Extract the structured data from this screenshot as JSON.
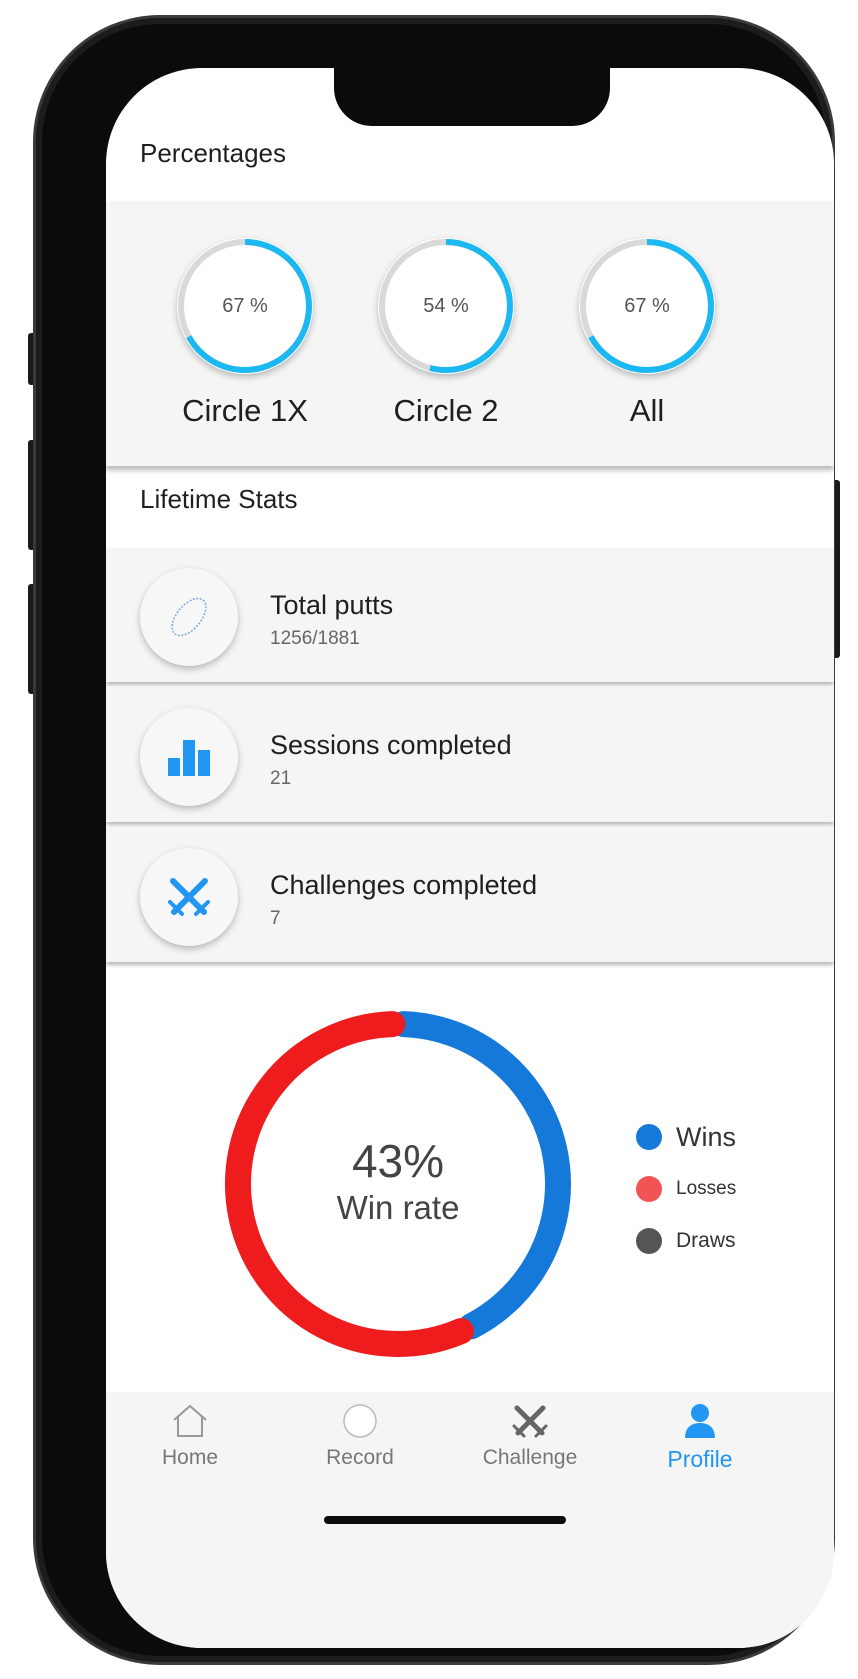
{
  "percentages": {
    "title": "Percentages",
    "gauges": [
      {
        "label": "Circle 1X",
        "value_text": "67 %",
        "value": 67
      },
      {
        "label": "Circle 2",
        "value_text": "54 %",
        "value": 54
      },
      {
        "label": "All",
        "value_text": "67 %",
        "value": 67
      }
    ]
  },
  "lifetime": {
    "title": "Lifetime Stats",
    "stats": [
      {
        "title": "Total putts",
        "value": "1256/1881",
        "icon": "putt-ball-icon"
      },
      {
        "title": "Sessions completed",
        "value": "21",
        "icon": "bar-chart-icon"
      },
      {
        "title": "Challenges completed",
        "value": "7",
        "icon": "crossed-swords-icon"
      }
    ]
  },
  "winrate": {
    "percent_text": "43%",
    "label": "Win rate",
    "legend": [
      {
        "label": "Wins",
        "color": "#1479d8"
      },
      {
        "label": "Losses",
        "color": "#f25355"
      },
      {
        "label": "Draws",
        "color": "#555555"
      }
    ]
  },
  "chart_data": {
    "type": "pie",
    "categories": [
      "Wins",
      "Losses",
      "Draws"
    ],
    "values": [
      43,
      57,
      0
    ],
    "colors": [
      "#1479d8",
      "#ee1c1c",
      "#555555"
    ],
    "legend_position": "right"
  },
  "nav": {
    "items": [
      {
        "label": "Home",
        "icon": "home-icon",
        "active": false
      },
      {
        "label": "Record",
        "icon": "record-icon",
        "active": false
      },
      {
        "label": "Challenge",
        "icon": "crossed-swords-icon",
        "active": false
      },
      {
        "label": "Profile",
        "icon": "person-icon",
        "active": true
      }
    ]
  },
  "colors": {
    "accent": "#2196f3",
    "gauge_progress": "#1bb8f2",
    "gauge_track": "#d9d9d9",
    "card_bg": "#f5f5f5"
  }
}
